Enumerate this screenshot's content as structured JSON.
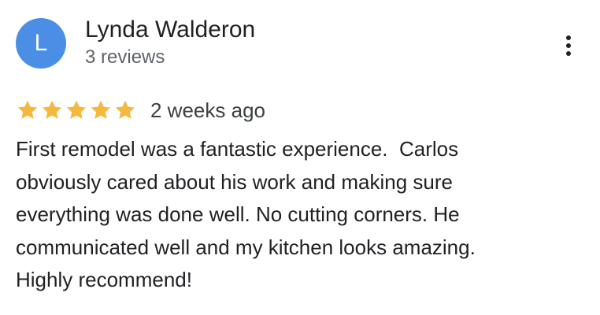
{
  "reviewer": {
    "avatar_initial": "L",
    "avatar_color": "#4a8ee6",
    "name": "Lynda Walderon",
    "review_count": "3 reviews"
  },
  "menu": {
    "icon": "more-vertical-icon"
  },
  "review": {
    "rating": 5,
    "rating_max": 5,
    "star_color": "#f4b83c",
    "time": "2 weeks ago",
    "text_lines": [
      "First remodel was a fantastic experience.  Carlos",
      "obviously cared about his work and making sure",
      "everything was done well. No cutting corners. He",
      "communicated well and my kitchen looks amazing.",
      "Highly recommend!"
    ]
  }
}
